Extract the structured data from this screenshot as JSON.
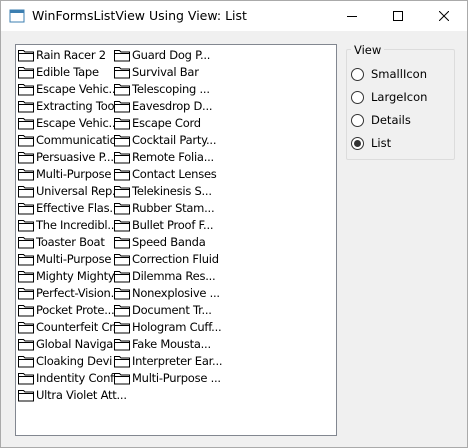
{
  "window": {
    "title": "WinFormsListView Using View: List"
  },
  "listview": {
    "columns": [
      [
        "Rain Racer 2",
        "Edible Tape",
        "Escape Vehic...",
        "Extracting Tool",
        "Escape Vehic...",
        "Communicatio...",
        "Persuasive P...",
        "Multi-Purpose ...",
        "Universal Rep...",
        "Effective Flas...",
        "The Incredibl...",
        "Toaster Boat",
        "Multi-Purpose ...",
        "Mighty Mighty...",
        "Perfect-Vision...",
        "Pocket Prote...",
        "Counterfeit Cr...",
        "Global Naviga...",
        "Cloaking Devi",
        "Indentity Conf...",
        "Ultra Violet Att..."
      ],
      [
        "Guard Dog P...",
        "Survival Bar",
        "Telescoping ...",
        "Eavesdrop D...",
        "Escape Cord",
        "Cocktail Party...",
        "Remote Folia...",
        "Contact Lenses",
        "Telekinesis S...",
        "Rubber Stam...",
        "Bullet Proof F...",
        "Speed Banda",
        "Correction Fluid",
        "Dilemma Res...",
        "Nonexplosive ...",
        "Document Tr...",
        "Hologram Cuff...",
        "Fake Mousta...",
        "Interpreter Ear...",
        "Multi-Purpose ..."
      ]
    ],
    "item_icon": "folder-icon"
  },
  "view_group": {
    "title": "View",
    "options": [
      {
        "label": "SmallIcon",
        "checked": false
      },
      {
        "label": "LargeIcon",
        "checked": false
      },
      {
        "label": "Details",
        "checked": false
      },
      {
        "label": "List",
        "checked": true
      }
    ]
  }
}
